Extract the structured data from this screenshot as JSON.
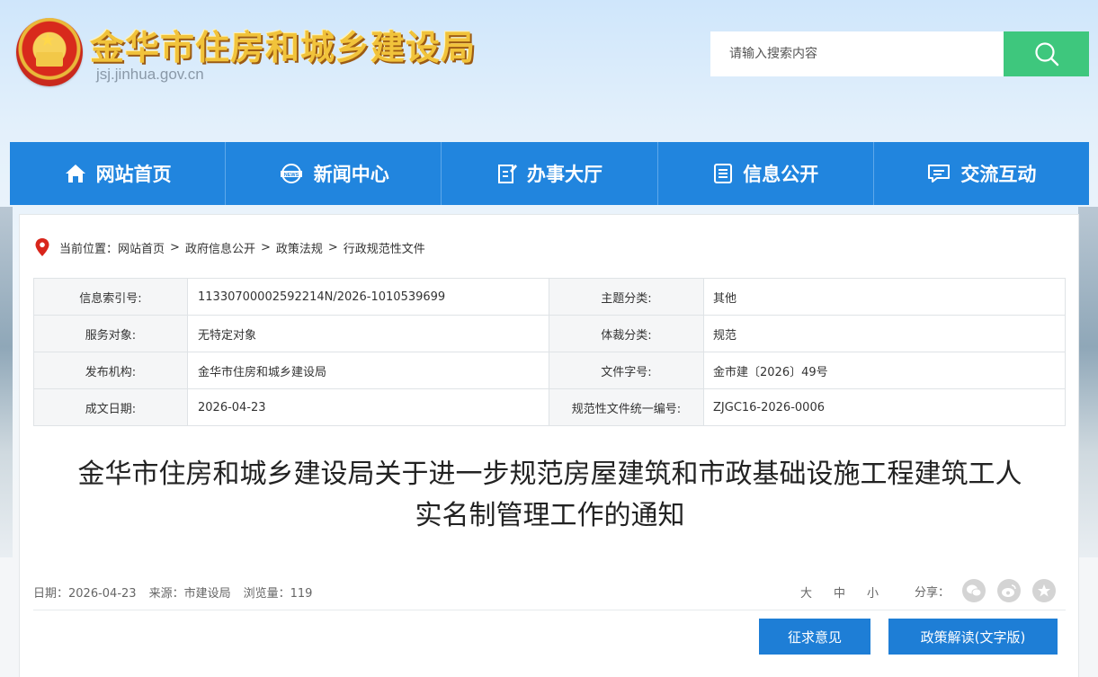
{
  "header": {
    "site_title": "金华市住房和城乡建设局",
    "domain": "jsj.jinhua.gov.cn",
    "search_placeholder": "请输入搜索内容"
  },
  "nav": [
    {
      "label": "网站首页",
      "icon": "home-icon"
    },
    {
      "label": "新闻中心",
      "icon": "news-icon"
    },
    {
      "label": "办事大厅",
      "icon": "edit-doc-icon"
    },
    {
      "label": "信息公开",
      "icon": "list-doc-icon"
    },
    {
      "label": "交流互动",
      "icon": "chat-icon"
    }
  ],
  "breadcrumb": {
    "prefix": "当前位置：",
    "items": [
      "网站首页",
      "政府信息公开",
      "政策法规",
      "行政规范性文件"
    ],
    "separator": ">"
  },
  "meta": {
    "rows": [
      {
        "k1": "信息索引号:",
        "v1": "11330700002592214N/2026-1010539699",
        "k2": "主题分类:",
        "v2": "其他"
      },
      {
        "k1": "服务对象:",
        "v1": "无特定对象",
        "k2": "体裁分类:",
        "v2": "规范"
      },
      {
        "k1": "发布机构:",
        "v1": "金华市住房和城乡建设局",
        "k2": "文件字号:",
        "v2": "金市建〔2026〕49号"
      },
      {
        "k1": "成文日期:",
        "v1": "2026-04-23",
        "k2": "规范性文件统一编号:",
        "v2": "ZJGC16-2026-0006"
      }
    ]
  },
  "document": {
    "title_line1": "金华市住房和城乡建设局关于进一步规范房屋建筑和市政基础设施工程建筑工人",
    "title_line2": "实名制管理工作的通知"
  },
  "info": {
    "date": "日期：2026-04-23",
    "source": "来源：市建设局",
    "views": "浏览量：119"
  },
  "font_size": {
    "large": "大",
    "medium": "中",
    "small": "小"
  },
  "share": {
    "label": "分享："
  },
  "buttons": {
    "feedback": "征求意见",
    "interpretation": "政策解读(文字版)"
  },
  "colors": {
    "nav_blue": "#2185de",
    "search_green": "#3ec77d",
    "title_gold": "#f1c33b",
    "button_blue": "#1e7ed6"
  }
}
